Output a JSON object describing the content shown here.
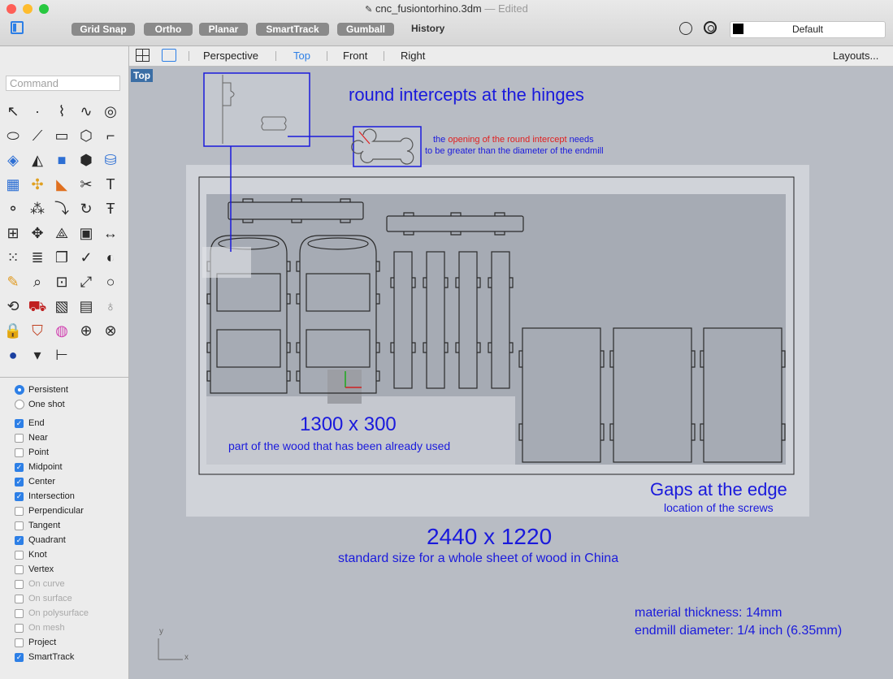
{
  "window": {
    "title": "cnc_fusiontorhino.3dm",
    "status": "— Edited",
    "traffic_colors": [
      "#fe5f57",
      "#febc2e",
      "#28c840"
    ]
  },
  "toolbar": {
    "buttons": [
      "Grid Snap",
      "Ortho",
      "Planar",
      "SmartTrack",
      "Gumball"
    ],
    "history": "History",
    "layer": "Default"
  },
  "command": {
    "placeholder": "Command"
  },
  "tools": [
    "arrow-icon",
    "point-icon",
    "polyline-icon",
    "curve-icon",
    "circle-icon",
    "ellipse-icon",
    "polycurve-icon",
    "rectangle-icon",
    "polygon-icon",
    "fillet-icon",
    "surface-icon",
    "lofted-icon",
    "box-icon",
    "boolean-icon",
    "cylinder-icon",
    "mesh-icon",
    "puzzle-icon",
    "extrude-icon",
    "trim-icon",
    "text-icon",
    "sphere-group-icon",
    "spheres-icon",
    "arc-arrow-icon",
    "rotate-icon",
    "t-text-icon",
    "grid-icon",
    "move-icon",
    "explode-icon",
    "block-icon",
    "dimension-icon",
    "array-icon",
    "layers-icon",
    "paste-icon",
    "check-icon",
    "shade-icon",
    "paint-icon",
    "zoom-icon",
    "zoom-window-icon",
    "zoom-extents-icon",
    "zoom-selected-icon",
    "orbit-icon",
    "car-icon",
    "texture-icon",
    "layout-icon",
    "bulb-icon",
    "lock-icon",
    "shield-icon",
    "color-wheel-icon",
    "sphere-wire-icon",
    "sphere-grid-icon",
    "globe-icon",
    "pen-icon",
    "tree-icon"
  ],
  "osnap": {
    "modes": [
      {
        "label": "Persistent",
        "on": true
      },
      {
        "label": "One shot",
        "on": false
      }
    ],
    "items": [
      {
        "label": "End",
        "on": true,
        "enabled": true
      },
      {
        "label": "Near",
        "on": false,
        "enabled": true
      },
      {
        "label": "Point",
        "on": false,
        "enabled": true
      },
      {
        "label": "Midpoint",
        "on": true,
        "enabled": true
      },
      {
        "label": "Center",
        "on": true,
        "enabled": true
      },
      {
        "label": "Intersection",
        "on": true,
        "enabled": true
      },
      {
        "label": "Perpendicular",
        "on": false,
        "enabled": true
      },
      {
        "label": "Tangent",
        "on": false,
        "enabled": true
      },
      {
        "label": "Quadrant",
        "on": true,
        "enabled": true
      },
      {
        "label": "Knot",
        "on": false,
        "enabled": true
      },
      {
        "label": "Vertex",
        "on": false,
        "enabled": true
      },
      {
        "label": "On curve",
        "on": false,
        "enabled": false
      },
      {
        "label": "On surface",
        "on": false,
        "enabled": false
      },
      {
        "label": "On polysurface",
        "on": false,
        "enabled": false
      },
      {
        "label": "On mesh",
        "on": false,
        "enabled": false
      },
      {
        "label": "Project",
        "on": false,
        "enabled": true
      },
      {
        "label": "SmartTrack",
        "on": true,
        "enabled": true
      }
    ]
  },
  "tabs": {
    "items": [
      "Perspective",
      "Top",
      "Front",
      "Right"
    ],
    "active": "Top",
    "layouts": "Layouts..."
  },
  "viewport": {
    "label": "Top",
    "axis_x": "x",
    "axis_y": "y",
    "annotations": {
      "hinges_title": "round intercepts at the hinges",
      "hinges_note1_a": "the",
      "hinges_note1_b": "opening of the round intercept",
      "hinges_note1_c": "needs",
      "hinges_note2": "to be greater than the diameter of the endmill",
      "used_size": "1300 x 300",
      "used_note": "part of the wood that has been already used",
      "gaps_title": "Gaps at the edge",
      "gaps_note": "location of the screws",
      "sheet_size": "2440 x 1220",
      "sheet_note": "standard size for a whole sheet of wood in China",
      "material": "material thickness: 14mm",
      "endmill": "endmill diameter: 1/4 inch (6.35mm)"
    },
    "colors": {
      "annotation": "#1a1adc",
      "highlight": "#e02020",
      "outline": "#2a2a2a"
    }
  }
}
